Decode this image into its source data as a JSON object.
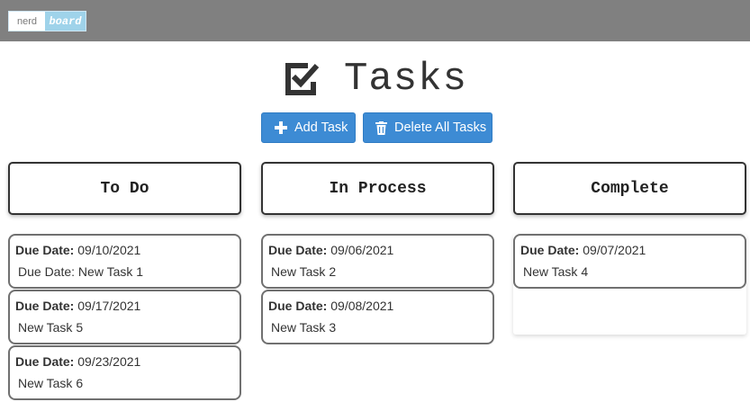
{
  "brand": {
    "part1": "nerd",
    "part2": "board"
  },
  "page_title": "Tasks",
  "buttons": {
    "add_task": "Add Task",
    "delete_all": "Delete All Tasks"
  },
  "columns": [
    {
      "title": "To Do",
      "tasks": [
        {
          "due_label": "Due Date:",
          "due_date": "09/10/2021",
          "name": "Due Date: New Task 1"
        },
        {
          "due_label": "Due Date:",
          "due_date": "09/17/2021",
          "name": "New Task 5"
        },
        {
          "due_label": "Due Date:",
          "due_date": "09/23/2021",
          "name": "New Task 6"
        }
      ]
    },
    {
      "title": "In Process",
      "tasks": [
        {
          "due_label": "Due Date:",
          "due_date": "09/06/2021",
          "name": "New Task 2"
        },
        {
          "due_label": "Due Date:",
          "due_date": "09/08/2021",
          "name": "New Task 3"
        }
      ]
    },
    {
      "title": "Complete",
      "tasks": [
        {
          "due_label": "Due Date:",
          "due_date": "09/07/2021",
          "name": "New Task 4"
        }
      ]
    }
  ],
  "colors": {
    "topbar": "#808080",
    "button": "#3d8bd4",
    "card_border": "#707070"
  },
  "icons": {
    "title": "checkbox-checked-icon",
    "add": "plus-icon",
    "delete": "trash-icon"
  }
}
